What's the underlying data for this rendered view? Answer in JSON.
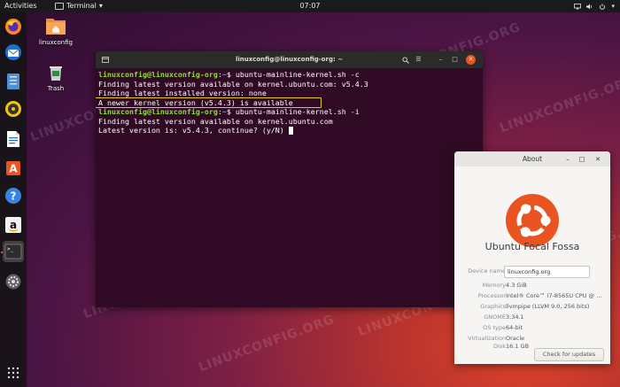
{
  "topbar": {
    "activities": "Activities",
    "app_menu": "Terminal",
    "clock": "07:07"
  },
  "dock": {
    "items": [
      "firefox-icon",
      "thunderbird-icon",
      "files-icon",
      "rhythmbox-icon",
      "libreoffice-writer-icon",
      "software-center-icon",
      "help-icon",
      "amazon-icon",
      "terminal-icon",
      "settings-icon"
    ],
    "active": "terminal-icon"
  },
  "desktop": {
    "icons": [
      {
        "label": "linuxconfig"
      },
      {
        "label": "Trash"
      }
    ]
  },
  "terminal": {
    "title": "linuxconfig@linuxconfig-org: ~",
    "lines": [
      {
        "user": "linuxconfig@linuxconfig-org",
        "sep": ":",
        "path": "~",
        "cmd": "$ ubuntu-mainline-kernel.sh -c"
      },
      {
        "text": "Finding latest version available on kernel.ubuntu.com: v5.4.3"
      },
      {
        "text": "Finding latest installed version: none"
      },
      {
        "text": "A newer kernel version (v5.4.3) is available"
      },
      {
        "user": "linuxconfig@linuxconfig-org",
        "sep": ":",
        "path": "~",
        "cmd": "$ ubuntu-mainline-kernel.sh -i"
      },
      {
        "text": "Finding latest version available on kernel.ubuntu.com"
      },
      {
        "text": "Latest version is: v5.4.3, continue? (y/N) "
      }
    ]
  },
  "about": {
    "title": "About",
    "distro": "Ubuntu Focal Fossa",
    "device_name_label": "Device name",
    "device_name": "linuxconfig.org",
    "memory_label": "Memory",
    "memory": "4.3 GiB",
    "processor_label": "Processor",
    "processor": "Intel® Core™ i7-8565U CPU @ …",
    "graphics_label": "Graphics",
    "graphics": "llvmpipe (LLVM 9.0, 256 bits)",
    "gnome_label": "GNOME",
    "gnome": "3.34.1",
    "os_type_label": "OS type",
    "os_type": "64-bit",
    "virtualization_label": "Virtualization",
    "virtualization": "Oracle",
    "disk_label": "Disk",
    "disk": "16.1 GB",
    "updates_button": "Check for updates"
  },
  "watermark": "LINUXCONFIG.ORG",
  "colors": {
    "terminal_bg": "#300a24",
    "prompt_user": "#8ae234",
    "prompt_path": "#729fcf",
    "highlight": "#e9c60f",
    "ubuntu_orange": "#e95420"
  }
}
